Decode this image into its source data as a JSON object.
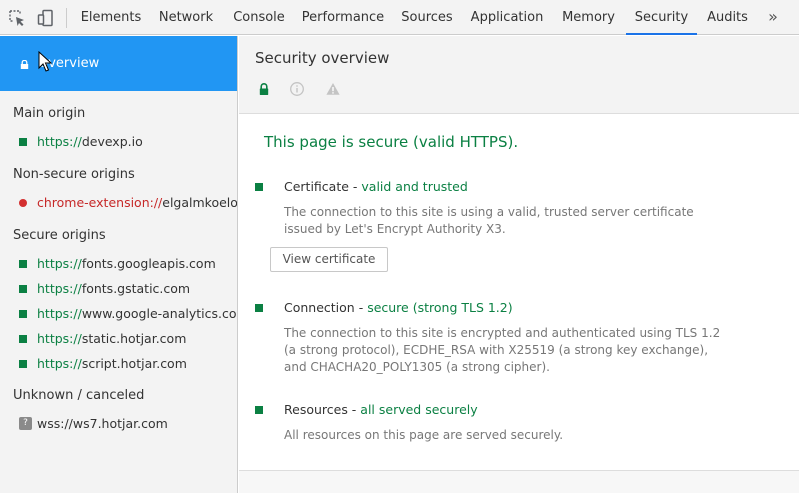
{
  "toolbar": {
    "icons": [
      "inspect-element-icon",
      "device-toolbar-icon",
      "more-tabs-icon"
    ],
    "tabs": [
      {
        "label": "Elements"
      },
      {
        "label": "Network"
      },
      {
        "label": "Console"
      },
      {
        "label": "Performance"
      },
      {
        "label": "Sources"
      },
      {
        "label": "Application"
      },
      {
        "label": "Memory"
      },
      {
        "label": "Security",
        "active": true
      },
      {
        "label": "Audits"
      }
    ],
    "more_glyph": "»"
  },
  "sidebar": {
    "overview_label": "Overview",
    "groups": [
      {
        "title": "Main origin",
        "origins": [
          {
            "scheme": "https://",
            "host": "devexp.io",
            "status": "secure"
          }
        ]
      },
      {
        "title": "Non-secure origins",
        "origins": [
          {
            "scheme": "chrome-extension://",
            "host": "elgalmkoelokbchhkhacckoklkejnhcd",
            "status": "insecure"
          }
        ]
      },
      {
        "title": "Secure origins",
        "origins": [
          {
            "scheme": "https://",
            "host": "fonts.googleapis.com",
            "status": "secure"
          },
          {
            "scheme": "https://",
            "host": "fonts.gstatic.com",
            "status": "secure"
          },
          {
            "scheme": "https://",
            "host": "www.google-analytics.com",
            "status": "secure"
          },
          {
            "scheme": "https://",
            "host": "static.hotjar.com",
            "status": "secure"
          },
          {
            "scheme": "https://",
            "host": "script.hotjar.com",
            "status": "secure"
          }
        ]
      },
      {
        "title": "Unknown / canceled",
        "origins": [
          {
            "scheme": "",
            "host": "wss://ws7.hotjar.com",
            "status": "unknown",
            "badge": "?"
          }
        ]
      }
    ]
  },
  "main": {
    "title": "Security overview",
    "header_icons": [
      "lock-icon",
      "info-icon",
      "warning-icon"
    ],
    "summary": "This page is secure (valid HTTPS).",
    "sections": [
      {
        "label": "Certificate - ",
        "status": "valid and trusted",
        "description": "The connection to this site is using a valid, trusted server certificate issued by Let's Encrypt Authority X3.",
        "button": "View certificate"
      },
      {
        "label": "Connection - ",
        "status": "secure (strong TLS 1.2)",
        "description": "The connection to this site is encrypted and authenticated using TLS 1.2 (a strong protocol), ECDHE_RSA with X25519 (a strong key exchange), and CHACHA20_POLY1305 (a strong cipher)."
      },
      {
        "label": "Resources - ",
        "status": "all served securely",
        "description": "All resources on this page are served securely."
      }
    ]
  },
  "colors": {
    "accent_blue": "#2196f3",
    "secure_green": "#0b8043",
    "insecure_red": "#d32f2f",
    "active_tab_underline": "#1a73e8"
  }
}
